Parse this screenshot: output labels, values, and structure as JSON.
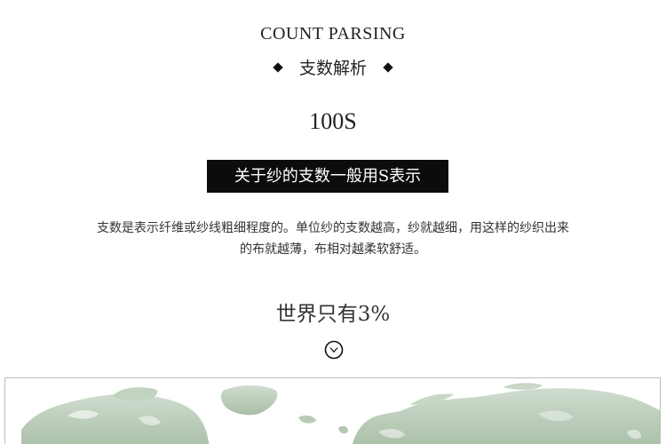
{
  "heading": {
    "english": "COUNT PARSING",
    "chinese": "支数解析"
  },
  "count_value": "100S",
  "banner_text": "关于纱的支数一般用S表示",
  "description": {
    "line1": "支数是表示纤维或纱线粗细程度的。单位纱的支数越高，纱就越细，用这样的纱织出来",
    "line2": "的布就越薄，布相对越柔软舒适。"
  },
  "world_title": "世界只有3%",
  "icons": {
    "bullet": "diamond-icon",
    "scroll": "chevron-down-circle-icon",
    "map": "world-map-illustration"
  },
  "colors": {
    "text": "#222222",
    "banner_bg": "#0c0c0c",
    "banner_text": "#ffffff",
    "map_land": "#b7c9b5"
  }
}
